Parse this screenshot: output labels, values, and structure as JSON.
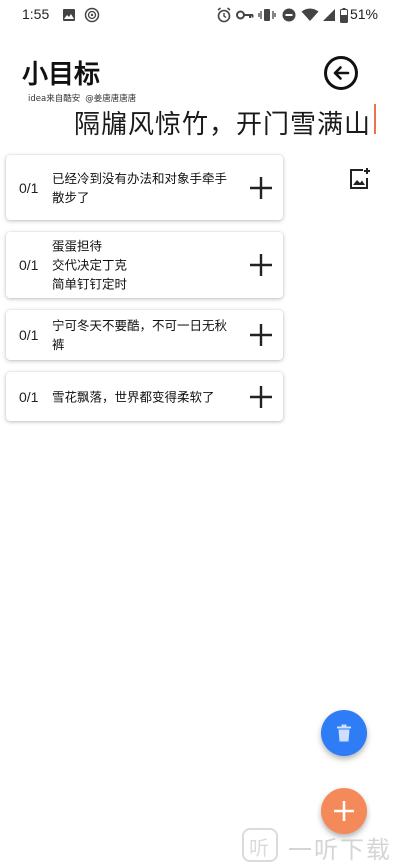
{
  "status_bar": {
    "time": "1:55",
    "battery": "51%",
    "icons": [
      "image-icon",
      "podcast-icon",
      "alarm-icon",
      "key-icon",
      "vibrate-icon",
      "dnd-icon",
      "wifi-icon",
      "signal-icon",
      "battery-icon"
    ]
  },
  "header": {
    "title": "小目标",
    "credit_idea": "idea来自酷安",
    "credit_author": "@姜唐唐唐唐",
    "back_icon": "arrow-left-circle-icon"
  },
  "poem": "隔牖风惊竹，开门雪满山",
  "add_image_icon": "add-image-icon",
  "goals": [
    {
      "count": "0/1",
      "lines": [
        "已经冷到没有办法和对象手牵手",
        "散步了"
      ]
    },
    {
      "count": "0/1",
      "lines": [
        "蛋蛋担待",
        "交代决定丁克",
        "简单钉钉定时"
      ]
    },
    {
      "count": "0/1",
      "lines": [
        "宁可冬天不要酷，不可一日无秋",
        "裤"
      ]
    },
    {
      "count": "0/1",
      "lines": [
        "雪花飘落，世界都变得柔软了"
      ]
    }
  ],
  "fabs": {
    "delete_icon": "trash-icon",
    "add_icon": "plus-icon",
    "delete_color": "#2e7cf6",
    "add_color": "#f4895a"
  },
  "watermark": {
    "logo_char": "听",
    "text": "一听下载"
  }
}
